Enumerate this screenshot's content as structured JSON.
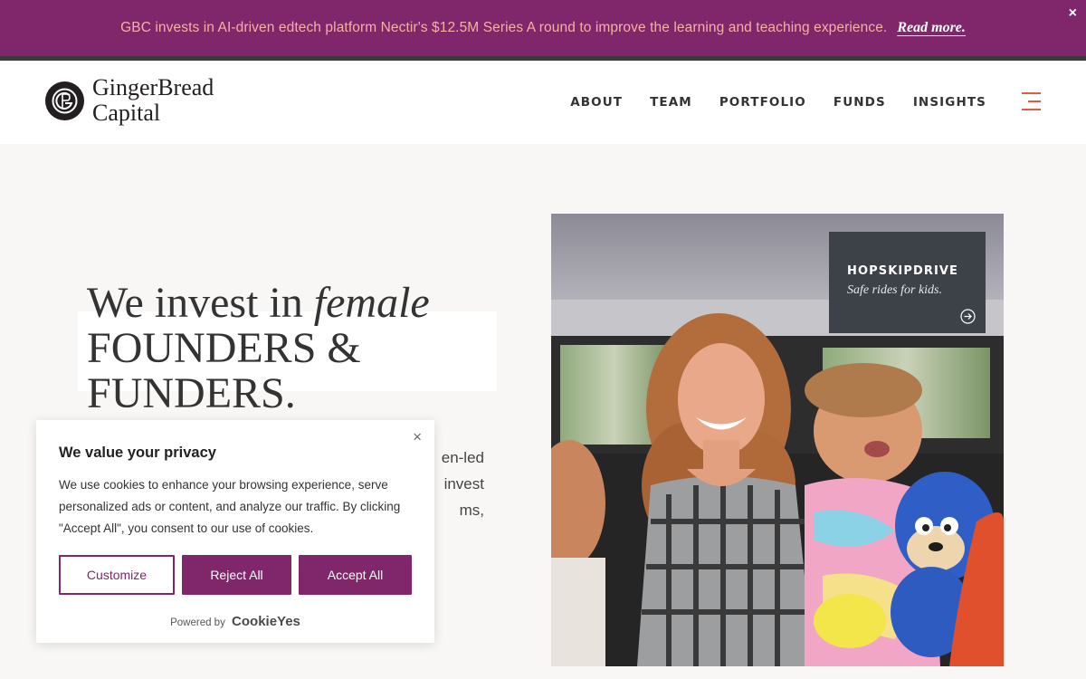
{
  "announcement": {
    "text": "GBC invests in AI-driven edtech platform Nectir's $12.5M Series A round to improve the learning and teaching experience.",
    "link": "Read more.",
    "close_glyph": "×"
  },
  "header": {
    "logo_line1": "GingerBread",
    "logo_line2": "Capital",
    "nav": [
      "ABOUT",
      "TEAM",
      "PORTFOLIO",
      "FUNDS",
      "INSIGHTS"
    ],
    "menu_icon": "hamburger-icon"
  },
  "hero": {
    "title_part1": "We invest in ",
    "title_italic": "female",
    "title_line2": "FOUNDERS &",
    "title_line3": "FUNDERS.",
    "body_lines": [
      "en-led",
      "invest",
      "ms,"
    ]
  },
  "portfolio_card": {
    "title": "HOPSKIPDRIVE",
    "subtitle": "Safe rides for kids.",
    "arrow_icon": "arrow-circle-icon"
  },
  "cookie": {
    "title": "We value your privacy",
    "text": "We use cookies to enhance your browsing experience, serve personalized ads or content, and analyze our traffic. By clicking \"Accept All\", you consent to our use of cookies.",
    "customize": "Customize",
    "reject": "Reject All",
    "accept": "Accept All",
    "powered_by": "Powered by",
    "brand": "CookieYes",
    "close_glyph": "×"
  },
  "colors": {
    "brand_plum": "#80276b",
    "banner_text": "#f4b1a3",
    "menu_accent": "#e05d3f",
    "card_bg": "#3d4148"
  }
}
